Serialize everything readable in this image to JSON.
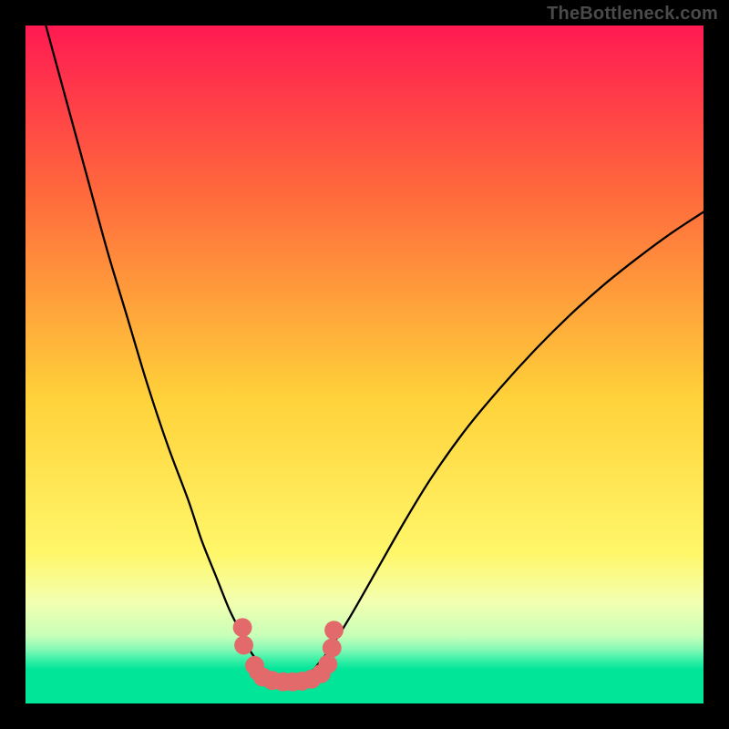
{
  "attribution": "TheBottleneck.com",
  "canvas": {
    "inner_w": 744,
    "inner_h": 744
  },
  "gradient_stops": [
    {
      "offset": 0.0,
      "color": "#ff1a52"
    },
    {
      "offset": 0.25,
      "color": "#ff6a3c"
    },
    {
      "offset": 0.55,
      "color": "#ffd23a"
    },
    {
      "offset": 0.78,
      "color": "#fff76a"
    },
    {
      "offset": 0.85,
      "color": "#f3ffb0"
    },
    {
      "offset": 0.9,
      "color": "#c8ffb8"
    },
    {
      "offset": 0.92,
      "color": "#86f9b6"
    },
    {
      "offset": 0.935,
      "color": "#3df0a8"
    },
    {
      "offset": 0.95,
      "color": "#00e598"
    },
    {
      "offset": 1.0,
      "color": "#00e598"
    }
  ],
  "chart_data": {
    "type": "line",
    "title": "",
    "xlabel": "",
    "ylabel": "",
    "x_range": [
      0,
      100
    ],
    "y_range": [
      0,
      100
    ],
    "series": [
      {
        "name": "left-curve",
        "x": [
          3,
          6,
          9,
          12,
          15,
          18,
          21,
          24,
          26,
          28,
          30,
          31.5,
          33,
          34,
          35,
          36,
          37
        ],
        "y": [
          100,
          89,
          78,
          67,
          57,
          47,
          38,
          30,
          24,
          19,
          14,
          11,
          8,
          6.5,
          5.2,
          4.3,
          3.8
        ]
      },
      {
        "name": "right-curve",
        "x": [
          41,
          42,
          43,
          45,
          48,
          52,
          56,
          60,
          65,
          70,
          75,
          80,
          85,
          90,
          95,
          100
        ],
        "y": [
          3.8,
          4.5,
          5.6,
          8.2,
          13,
          20,
          27,
          33.5,
          40.5,
          46.5,
          52,
          57,
          61.5,
          65.5,
          69.2,
          72.5
        ]
      },
      {
        "name": "valley-floor",
        "x": [
          34,
          35,
          36,
          37,
          38,
          39,
          40,
          41,
          42,
          43,
          44
        ],
        "y": [
          4.5,
          3.8,
          3.4,
          3.2,
          3.2,
          3.2,
          3.2,
          3.3,
          3.6,
          4.1,
          4.8
        ]
      }
    ],
    "markers": {
      "name": "valley-dots",
      "color": "#e26a6a",
      "radius_units": 1.4,
      "points": [
        {
          "x": 32.0,
          "y": 11.2
        },
        {
          "x": 32.2,
          "y": 8.6
        },
        {
          "x": 33.8,
          "y": 5.6
        },
        {
          "x": 35.0,
          "y": 3.9
        },
        {
          "x": 36.4,
          "y": 3.4
        },
        {
          "x": 38.0,
          "y": 3.2
        },
        {
          "x": 39.4,
          "y": 3.2
        },
        {
          "x": 40.8,
          "y": 3.3
        },
        {
          "x": 42.2,
          "y": 3.6
        },
        {
          "x": 43.6,
          "y": 4.4
        },
        {
          "x": 44.6,
          "y": 5.8
        },
        {
          "x": 45.2,
          "y": 8.2
        },
        {
          "x": 45.5,
          "y": 10.8
        }
      ]
    }
  }
}
